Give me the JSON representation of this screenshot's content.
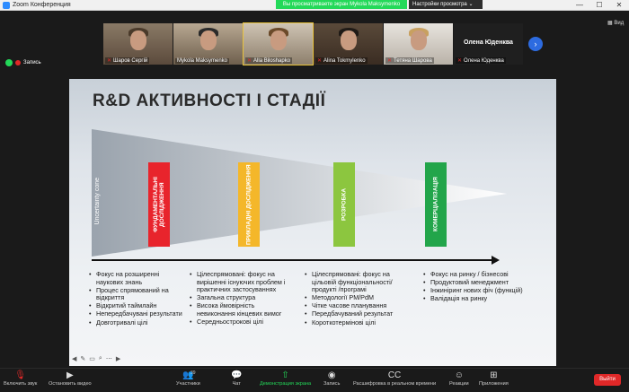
{
  "window": {
    "title": "Zoom Конференция",
    "minimize": "—",
    "maximize": "☐",
    "close": "✕"
  },
  "banner": {
    "share_text": "Вы просматриваете экран Mykola Maksymenko",
    "view_options": "Настройки просмотра"
  },
  "gallery": {
    "participants": [
      {
        "name": "Шаров Сергій",
        "muted": true
      },
      {
        "name": "Mykola Maksymenko",
        "muted": false
      },
      {
        "name": "Alla Biloshapko",
        "muted": true
      },
      {
        "name": "Alina Tokmylenko",
        "muted": true
      },
      {
        "name": "Тетяна Шарова",
        "muted": true
      },
      {
        "name": "Олена Юденква",
        "muted": true,
        "display_name": "Олена Юденква"
      }
    ],
    "view_label": "Вид"
  },
  "recording": {
    "label": "Запись"
  },
  "slide": {
    "title": "R&D АКТИВНОСТІ І СТАДІЇ",
    "uncertainty": "Uncertainty cone",
    "stages": [
      {
        "label": "ФУНДАМЕНТАЛЬНІ ДОСЛІДЖЕННЯ",
        "color": "#e8242c"
      },
      {
        "label": "ПРИКЛАДНІ ДОСЛІДЖЕННЯ",
        "color": "#f4b72a"
      },
      {
        "label": "РОЗРОБКА",
        "color": "#8cc63f"
      },
      {
        "label": "КОМЕРЦІАЛІЗАЦІЯ",
        "color": "#22a54a"
      }
    ],
    "columns": [
      [
        "Фокус на розширенні наукових знань",
        "Процес спрямований на відкриття",
        "Відкритий таймлайн",
        "Непередбачувані результати",
        "Довготривалі цілі"
      ],
      [
        "Цілеспрямовані: фокус на вирішенні існуючих проблем і практичних застосуваннях",
        "Загальна структура",
        "Висока ймовірність невиконання кінцевих вимог",
        "Середньострокові цілі"
      ],
      [
        "Цілеспрямовані: фокус на цільовій функціональності/ продукті /програмі",
        "Методології PM/PdM",
        "Чітке часове планування",
        "Передбачуваний результат",
        "Короткотермінові цілі"
      ],
      [
        "Фокус на ринку / бізнесові",
        "Продуктовий менеджмент",
        "Інжиніринг нових фіч (функцій)",
        "Валідація на ринку"
      ]
    ]
  },
  "toolbar": {
    "unmute": "Включить звук",
    "video": "Остановить видео",
    "participants": "Участники",
    "participants_count": "39",
    "chat": "Чат",
    "share": "Демонстрация экрана",
    "record": "Запись",
    "captions": "Расшифровка в реальном времени",
    "reactions": "Реакции",
    "apps": "Приложения",
    "leave": "Выйти"
  }
}
